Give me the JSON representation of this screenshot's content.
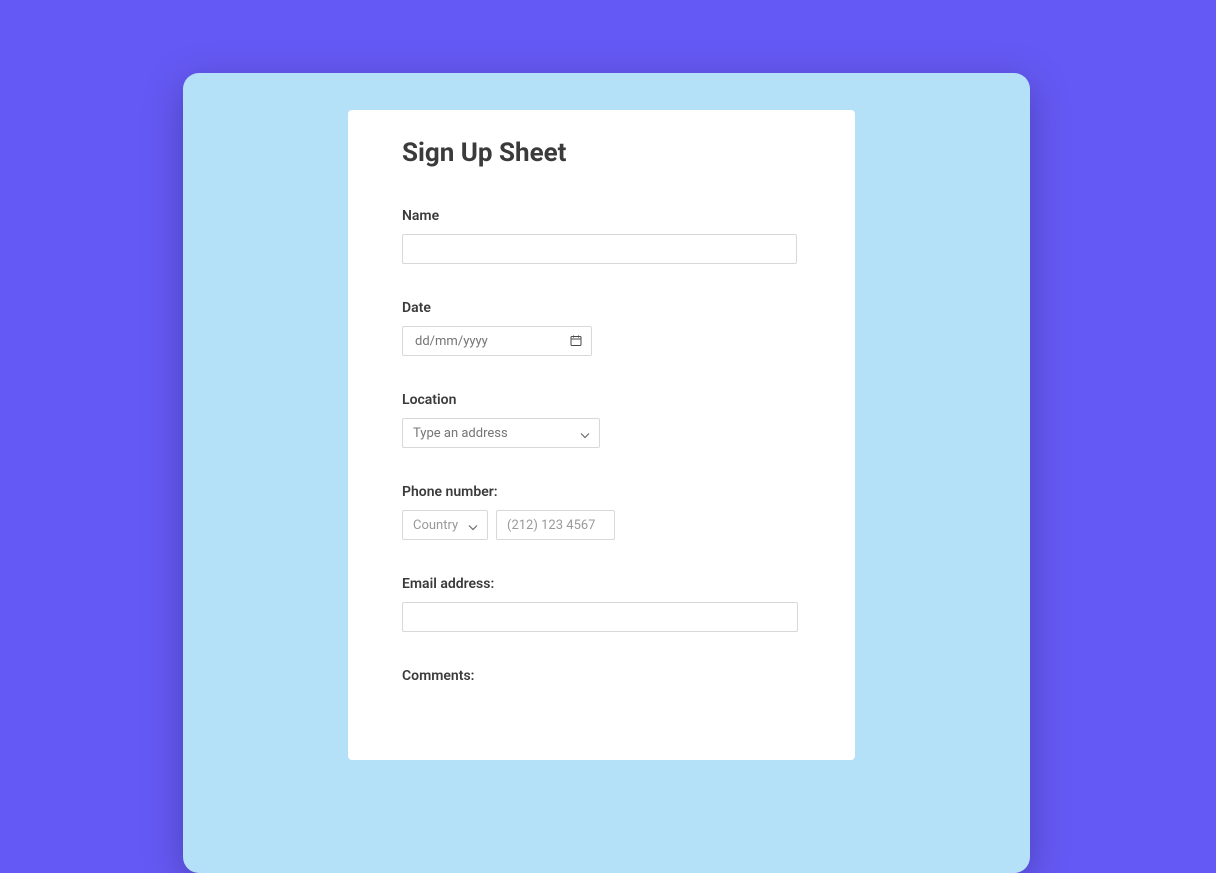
{
  "form": {
    "title": "Sign Up Sheet",
    "fields": {
      "name": {
        "label": "Name"
      },
      "date": {
        "label": "Date",
        "placeholder": "dd/mm/yyyy"
      },
      "location": {
        "label": "Location",
        "placeholder": "Type an address"
      },
      "phone": {
        "label": "Phone number:",
        "country_placeholder": "Country",
        "number_placeholder": "(212) 123 4567"
      },
      "email": {
        "label": "Email address:"
      },
      "comments": {
        "label": "Comments:"
      }
    }
  }
}
